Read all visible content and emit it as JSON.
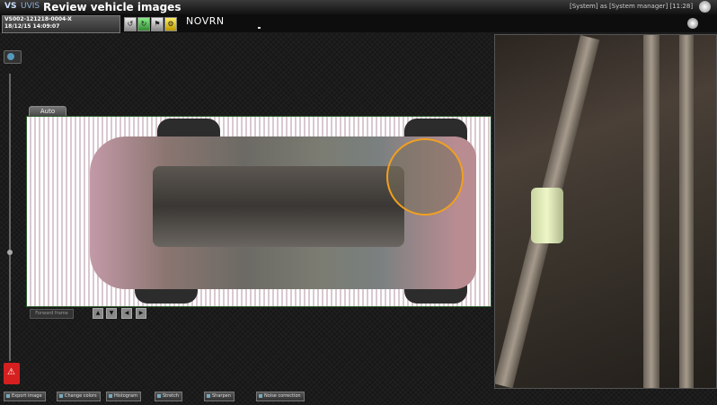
{
  "titlebar": {
    "logo": "VS",
    "brand": "UVIS",
    "title": "Review vehicle images",
    "user": "[System] as [System manager]   [11:28]"
  },
  "vehicle": {
    "id": "VS002-121218-0004-X",
    "datetime": "18/12/15 14:09:07",
    "plate": "NOVRN"
  },
  "toolbar": {
    "buttons": [
      "↺",
      "↻",
      "⚑",
      "⚙"
    ]
  },
  "view": {
    "tab": "Auto"
  },
  "controls": {
    "side_button": "Forward frame",
    "arrows": [
      "▲",
      "▼",
      "◀",
      "▶"
    ]
  },
  "bottom_buttons": [
    "Export image",
    "Change colors",
    "Histogram",
    "Stretch",
    "Sharpen",
    "Noise correction"
  ],
  "icons": {
    "alert": "alert-icon",
    "settings": "gear-icon",
    "zoom": "zoom-icon"
  }
}
